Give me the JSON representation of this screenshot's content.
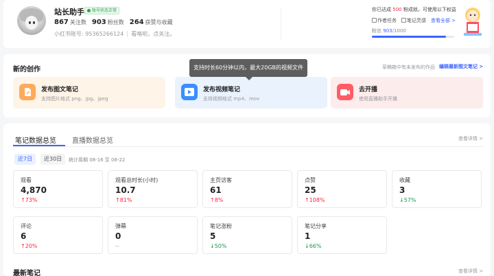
{
  "profile": {
    "username": "站长助手",
    "status_badge": "账号状态正常",
    "stats": [
      {
        "value": "867",
        "label": "关注数"
      },
      {
        "value": "903",
        "label": "粉丝数"
      },
      {
        "value": "264",
        "label": "获赞与收藏"
      }
    ],
    "account_id": "小红书账号: 95365266124",
    "bio": "看咯呃，点关注。"
  },
  "rights": {
    "title_prefix": "你已达成",
    "fans_goal": "500",
    "title_suffix": "粉成就，可使用以下权益",
    "link_tasks": "作者任务",
    "link_notes": "笔记灵感",
    "link_all": "查看全部 >",
    "fans_prefix": "粉丝",
    "fans_current": "903",
    "fans_total": "/1000",
    "progress": 0.903,
    "accent": "#3a64ff"
  },
  "creation": {
    "title": "新的创作",
    "drafts_hint": "草稿箱中有未发布的作品",
    "edit_link": "编辑最新图文笔记 >",
    "tooltip": "支持时长60分钟以内，最大20GB的视频文件",
    "tiles": [
      {
        "title": "发布图文笔记",
        "desc": "支持图片格式 png、jpg、jpeg",
        "icon": "image-note-icon"
      },
      {
        "title": "发布视频笔记",
        "desc": "支持视频格式 mp4、mov",
        "icon": "video-play-icon"
      },
      {
        "title": "去开播",
        "desc": "使用直播助手开播",
        "icon": "live-camera-icon"
      }
    ]
  },
  "data_overview": {
    "tabs": [
      "笔记数据总览",
      "直播数据总览"
    ],
    "view_detail": "查看详情 >",
    "periods": [
      "近7日",
      "近30日"
    ],
    "period_range": "统计周期 08-16 至 08-22",
    "metrics": [
      {
        "label": "观看",
        "value": "4,870",
        "change": "↑73%",
        "trend": "up"
      },
      {
        "label": "观看总时长(小时)",
        "value": "10.7",
        "change": "↑81%",
        "trend": "up"
      },
      {
        "label": "主页访客",
        "value": "61",
        "change": "↑8%",
        "trend": "up"
      },
      {
        "label": "点赞",
        "value": "25",
        "change": "↑108%",
        "trend": "up"
      },
      {
        "label": "收藏",
        "value": "3",
        "change": "↓57%",
        "trend": "down"
      },
      {
        "label": "评论",
        "value": "6",
        "change": "↑20%",
        "trend": "up"
      },
      {
        "label": "弹幕",
        "value": "0",
        "change": "--",
        "trend": "flat"
      },
      {
        "label": "笔记涨粉",
        "value": "5",
        "change": "↓50%",
        "trend": "down"
      },
      {
        "label": "笔记分享",
        "value": "1",
        "change": "↓66%",
        "trend": "down"
      }
    ]
  },
  "latest": {
    "title": "最新笔记",
    "view_detail": "查看详情 >"
  }
}
